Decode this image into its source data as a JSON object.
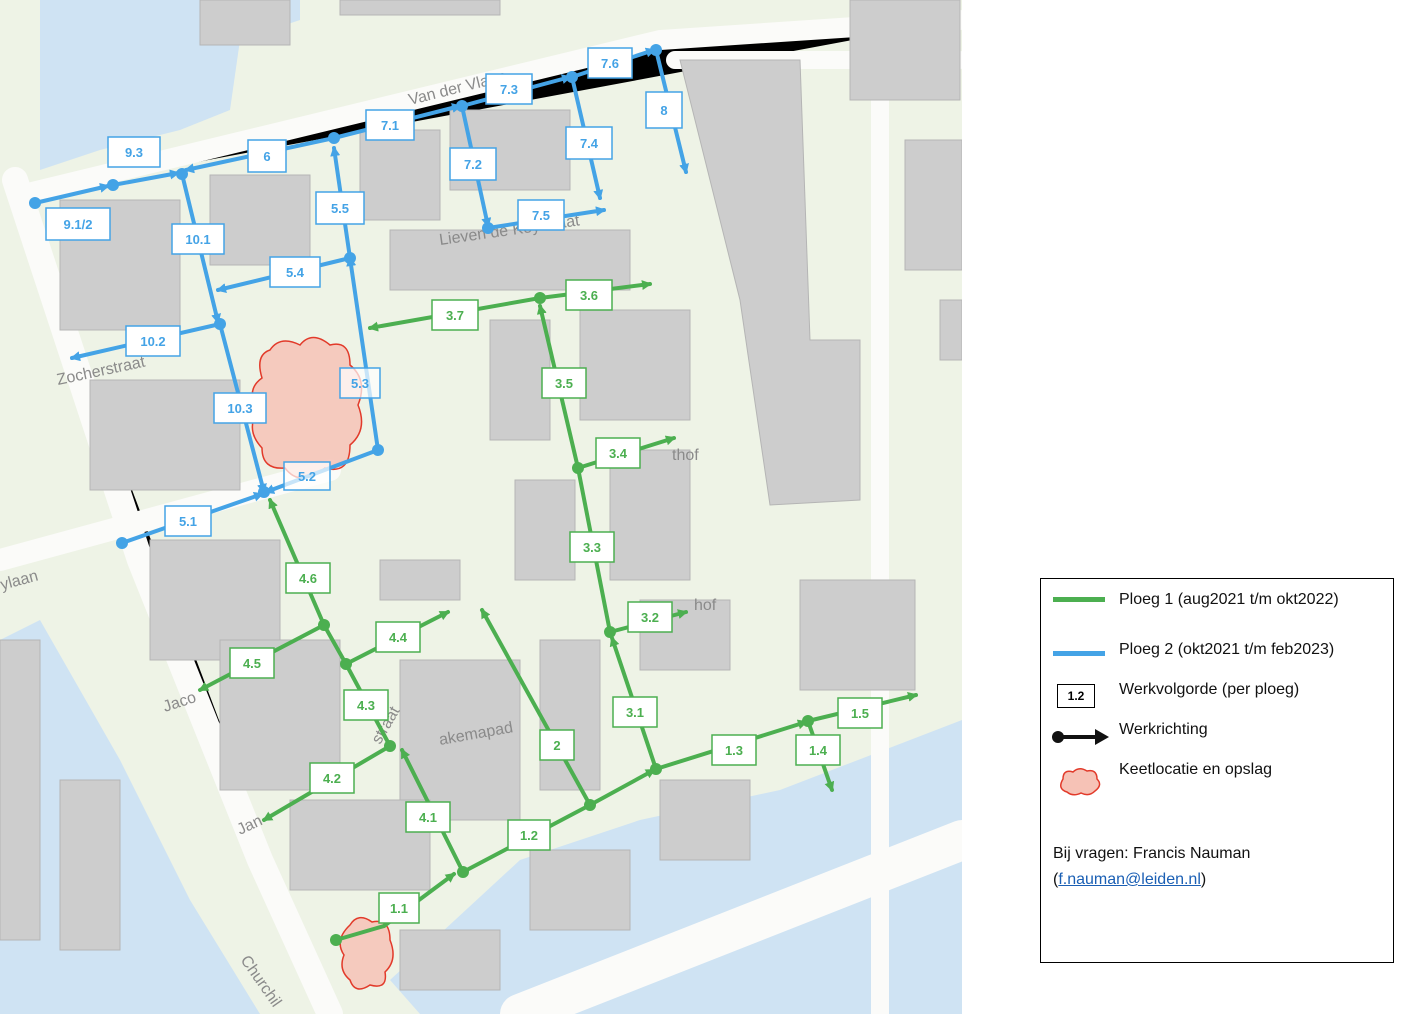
{
  "colors": {
    "ploeg1": "#4caf50",
    "ploeg2": "#44a3e6",
    "keet_fill": "#f6c2b6",
    "keet_stroke": "#e23a2a",
    "water": "#cfe3f3",
    "green_area": "#e6efd9",
    "building": "#cfcfcf",
    "road": "#f8f8f6"
  },
  "street_names": [
    {
      "key": "vanderlaan",
      "text": "Van der Vlaan"
    },
    {
      "key": "lievens",
      "text": "Lieven de Keystraat"
    },
    {
      "key": "zocher",
      "text": "Zocherstraat"
    },
    {
      "key": "ylaan",
      "text": "ylaan"
    },
    {
      "key": "jaco",
      "text": "Jaco"
    },
    {
      "key": "jan",
      "text": "Jan"
    },
    {
      "key": "straat1",
      "text": "straat"
    },
    {
      "key": "hof1",
      "text": "thof"
    },
    {
      "key": "hof2",
      "text": "hof"
    },
    {
      "key": "akemapad",
      "text": "akemapad"
    },
    {
      "key": "churchill",
      "text": "Churchil"
    }
  ],
  "segment_labels": {
    "p1": [
      "1.1",
      "1.2",
      "1.3",
      "1.4",
      "1.5",
      "2",
      "3.1",
      "3.2",
      "3.3",
      "3.4",
      "3.5",
      "3.6",
      "3.7",
      "4.1",
      "4.2",
      "4.3",
      "4.4",
      "4.5",
      "4.6"
    ],
    "p2": [
      "5.1",
      "5.2",
      "5.3",
      "5.4",
      "5.5",
      "6",
      "7.1",
      "7.2",
      "7.3",
      "7.4",
      "7.5",
      "7.6",
      "8",
      "9.1/2",
      "9.3",
      "10.1",
      "10.2",
      "10.3"
    ]
  },
  "legend": {
    "ploeg1": "Ploeg 1 (aug2021 t/m okt2022)",
    "ploeg2": "Ploeg 2 (okt2021 t/m feb2023)",
    "werkvolgorde_sample": "1.2",
    "werkvolgorde": "Werkvolgorde (per ploeg)",
    "werkrichting": "Werkrichting",
    "keetlocatie": "Keetlocatie en opslag",
    "contact_prefix": "Bij vragen: Francis Nauman",
    "contact_email": "f.nauman@leiden.nl",
    "paren_open": "(",
    "paren_close": ")"
  }
}
